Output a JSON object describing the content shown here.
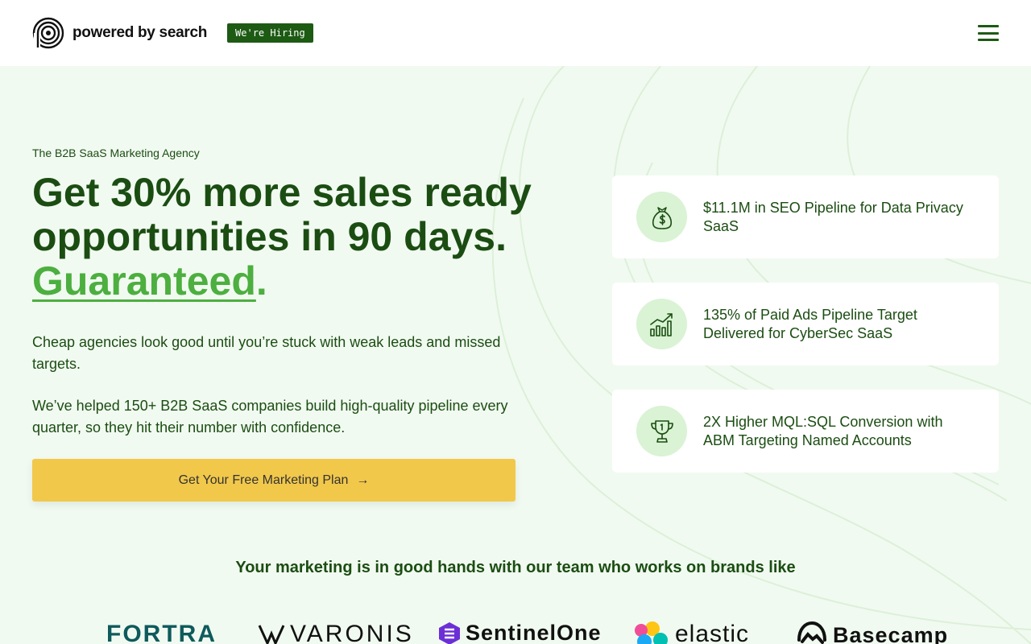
{
  "header": {
    "logo_text": "powered by search",
    "hiring_badge": "We're Hiring",
    "menu_icon": "hamburger-menu-icon"
  },
  "hero": {
    "eyebrow": "The B2B SaaS Marketing Agency",
    "headline_main": "Get 30% more sales ready opportunities in 90 days.",
    "headline_accent": "Guaranteed",
    "headline_dot": ".",
    "paragraph_1": "Cheap agencies look good until you’re stuck with weak leads and missed targets.",
    "paragraph_2": "We’ve helped 150+ B2B SaaS companies build high-quality pipeline every quarter, so they hit their number with confidence.",
    "cta_label": "Get Your Free Marketing Plan",
    "cta_arrow": "→"
  },
  "stats": [
    {
      "icon": "money-bag-icon",
      "text": "$11.1M in SEO Pipeline for Data Privacy SaaS"
    },
    {
      "icon": "bar-chart-growth-icon",
      "text": "135% of Paid Ads Pipeline Target Delivered for CyberSec SaaS"
    },
    {
      "icon": "trophy-icon",
      "text": "2X Higher MQL:SQL Conversion with ABM Targeting Named Accounts"
    }
  ],
  "brands": {
    "title": "Your marketing is in good hands with our team who works on brands like",
    "logos": [
      "FORTRA",
      "VARONIS",
      "SentinelOne",
      "elastic",
      "Basecamp"
    ]
  },
  "colors": {
    "brand_green": "#1b4d12",
    "accent_green": "#4caf3f",
    "cta_yellow": "#f2c84b",
    "hero_bg": "#f1faf1"
  }
}
